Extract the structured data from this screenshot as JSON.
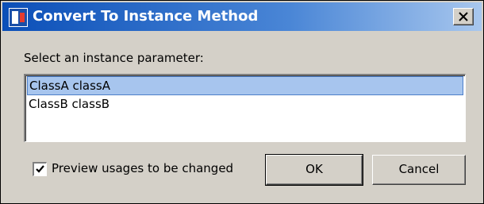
{
  "dialog": {
    "title": "Convert To Instance Method",
    "prompt_label": "Select an instance parameter:",
    "parameters": [
      {
        "label": "ClassA classA",
        "selected": true
      },
      {
        "label": "ClassB classB",
        "selected": false
      }
    ],
    "preview_checkbox": {
      "label": "Preview usages to be changed",
      "checked": true
    },
    "buttons": {
      "ok_label": "OK",
      "cancel_label": "Cancel"
    }
  },
  "icons": {
    "app": "app-icon",
    "close": "close-icon",
    "check": "checkmark-icon"
  },
  "colors": {
    "titlebar_start": "#0b4fb8",
    "titlebar_end": "#a8c7ee",
    "selection_bg": "#a7c5ee",
    "dialog_bg": "#d4d0c8"
  }
}
